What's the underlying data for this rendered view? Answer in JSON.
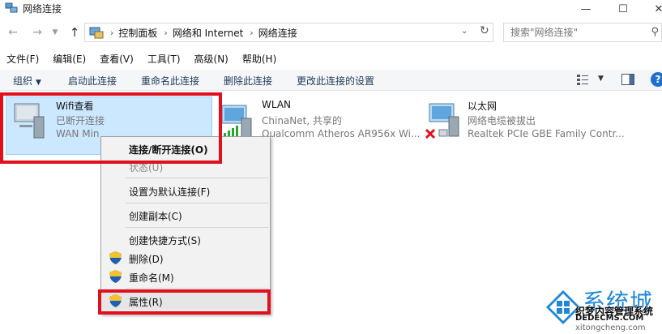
{
  "window": {
    "title": "网络连接",
    "icons": {
      "app": "network-connections-icon",
      "minimize": "minimize-icon",
      "maximize": "maximize-icon",
      "close": "close-icon"
    }
  },
  "navigation": {
    "breadcrumbs": [
      "控制面板",
      "网络和 Internet",
      "网络连接"
    ],
    "search_placeholder": "搜索\"网络连接\""
  },
  "menubar": [
    "文件(F)",
    "编辑(E)",
    "查看(V)",
    "工具(T)",
    "高级(N)",
    "帮助(H)"
  ],
  "commandbar": {
    "organize": "组织",
    "connect": "启动此连接",
    "rename": "重命名此连接",
    "delete": "删除此连接",
    "settings": "更改此连接的设置"
  },
  "adapters": [
    {
      "name": "Wifi查看",
      "status": "已断开连接",
      "device": "WAN Min",
      "selected": true
    },
    {
      "name": "WLAN",
      "status": "ChinaNet, 共享的",
      "device": "Qualcomm Atheros AR956x Wi..."
    },
    {
      "name": "以太网",
      "status": "网络电缆被拔出",
      "device": "Realtek PCIe GBE Family Contr..."
    }
  ],
  "context_menu": [
    {
      "label": "连接/断开连接(O)",
      "bold": true
    },
    {
      "label": "状态(U)",
      "disabled": true
    },
    {
      "label": "设置为默认连接(F)"
    },
    {
      "label": "创建副本(C)"
    },
    {
      "label": "创建快捷方式(S)"
    },
    {
      "label": "删除(D)",
      "shield": true
    },
    {
      "label": "重命名(M)",
      "shield": true
    },
    {
      "label": "属性(R)",
      "shield": true
    }
  ],
  "watermark": {
    "brand": "系统城",
    "line1": "织梦内容管理系统",
    "line2": "DEDECMS.COM",
    "line3": "xitongcheng.com"
  },
  "colors": {
    "highlight_red": "#e0101d",
    "selection": "#cce8ff",
    "accent_blue": "#1e88d8"
  }
}
